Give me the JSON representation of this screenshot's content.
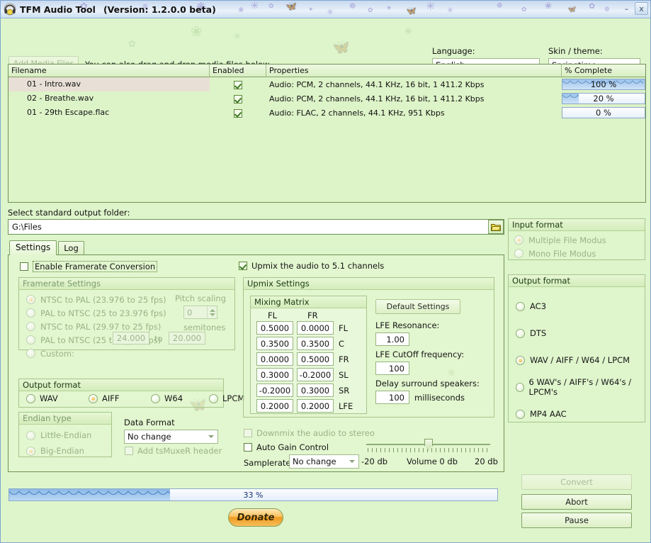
{
  "window": {
    "title": "TFM Audio Tool",
    "version": "(Version: 1.2.0.0 beta)",
    "minimize": "–",
    "maximize": "▫",
    "close": "x",
    "app_icon": "headphones-icon"
  },
  "topbar": {
    "add_media_label": "Add Media Files",
    "drag_hint": "You can also drag and drop media files below.",
    "language_label": "Language:",
    "language_value": "English",
    "skin_label": "Skin / theme:",
    "skin_value": "Springtime"
  },
  "filelist": {
    "columns": [
      "Filename",
      "Enabled",
      "Properties",
      "% Complete"
    ],
    "rows": [
      {
        "filename": "01 - Intro.wav",
        "enabled": true,
        "properties": "Audio: PCM, 2 channels, 44.1 KHz, 16 bit, 1 411.2 Kbps",
        "percent": 100,
        "percent_label": "100 %",
        "selected": true
      },
      {
        "filename": "02 - Breathe.wav",
        "enabled": true,
        "properties": "Audio: PCM, 2 channels, 44.1 KHz, 16 bit, 1 411.2 Kbps",
        "percent": 20,
        "percent_label": "20 %",
        "selected": false
      },
      {
        "filename": "01 - 29th Escape.flac",
        "enabled": true,
        "properties": "Audio: FLAC, 2 channels, 44.1 KHz, 951 Kbps",
        "percent": 0,
        "percent_label": "0 %",
        "selected": false
      }
    ]
  },
  "output_folder": {
    "label": "Select standard output folder:",
    "path": "G:\\Files",
    "browse_icon": "folder-open-icon"
  },
  "tabs": [
    {
      "label": "Settings",
      "active": true
    },
    {
      "label": "Log",
      "active": false
    }
  ],
  "settings": {
    "enable_framerate_conversion": {
      "label": "Enable Framerate Conversion",
      "checked": false
    },
    "upmix_51": {
      "label": "Upmix the audio to 5.1 channels",
      "checked": true
    },
    "framerate": {
      "title": "Framerate Settings",
      "options": [
        {
          "label": "NTSC to PAL (23.976 to 25 fps)",
          "selected": true
        },
        {
          "label": "PAL to NTSC (25 to 23.976 fps)",
          "selected": false
        },
        {
          "label": "NTSC to PAL (29.97 to 25 fps)",
          "selected": false
        },
        {
          "label": "PAL to NTSC (25 to 29.97 fps)",
          "selected": false
        },
        {
          "label": "Custom:",
          "selected": false
        }
      ],
      "custom_from": "24.000",
      "custom_to_label": "to",
      "custom_to": "20.000",
      "pitch_scaling_label": "Pitch scaling",
      "pitch_scaling_value": "0",
      "semitones_label": "semitones"
    },
    "output_format_local": {
      "title": "Output format",
      "options": [
        {
          "label": "WAV",
          "selected": false
        },
        {
          "label": "AIFF",
          "selected": true
        },
        {
          "label": "W64",
          "selected": false
        },
        {
          "label": "LPCM",
          "selected": false
        }
      ]
    },
    "endian": {
      "title": "Endian type",
      "options": [
        {
          "label": "Little-Endian",
          "selected": false
        },
        {
          "label": "Big-Endian",
          "selected": true
        }
      ]
    },
    "data_format": {
      "label": "Data Format",
      "value": "No change"
    },
    "tsmuxer": {
      "label": "Add tsMuxeR header",
      "checked": false
    },
    "upmix": {
      "title": "Upmix Settings",
      "matrix_title": "Mixing Matrix",
      "matrix_columns": [
        "FL",
        "FR"
      ],
      "matrix_rows": [
        {
          "name": "FL",
          "fl": "0.5000",
          "fr": "0.0000"
        },
        {
          "name": "C",
          "fl": "0.3500",
          "fr": "0.3500"
        },
        {
          "name": "FR",
          "fl": "0.0000",
          "fr": "0.5000"
        },
        {
          "name": "SL",
          "fl": "0.3000",
          "fr": "-0.2000"
        },
        {
          "name": "SR",
          "fl": "-0.2000",
          "fr": "0.3000"
        },
        {
          "name": "LFE",
          "fl": "0.2000",
          "fr": "0.2000"
        }
      ],
      "default_settings_label": "Default Settings",
      "lfe_resonance_label": "LFE Resonance:",
      "lfe_resonance_value": "1.00",
      "lfe_cutoff_label": "LFE CutOff frequency:",
      "lfe_cutoff_value": "100",
      "delay_label": "Delay surround speakers:",
      "delay_value": "100",
      "delay_unit": "milliseconds"
    },
    "downmix": {
      "label": "Downmix the audio to stereo",
      "checked": false
    },
    "auto_gain": {
      "label": "Auto Gain Control",
      "checked": false
    },
    "samplerate": {
      "label": "Samplerate:",
      "value": "No change"
    },
    "volume": {
      "min_label": "-20 db",
      "center_label": "Volume 0 db",
      "max_label": "20 db",
      "value": 0
    }
  },
  "input_format": {
    "title": "Input format",
    "options": [
      {
        "label": "Multiple File Modus",
        "selected": true
      },
      {
        "label": "Mono File Modus",
        "selected": false
      }
    ]
  },
  "output_format": {
    "title": "Output format",
    "options": [
      {
        "label": "AC3",
        "selected": false
      },
      {
        "label": "DTS",
        "selected": false
      },
      {
        "label": "WAV / AIFF / W64 / LPCM",
        "selected": true
      },
      {
        "label": "6 WAV's / AIFF's / W64's / LPCM's",
        "selected": false
      },
      {
        "label": "MP4 AAC",
        "selected": false
      }
    ]
  },
  "bottom": {
    "progress_percent": 33,
    "progress_label": "33 %",
    "donate_label": "Donate",
    "convert_label": "Convert",
    "abort_label": "Abort",
    "pause_label": "Pause"
  },
  "colors": {
    "background": "#def5cb",
    "title_bar": "#ccdff0",
    "group_border": "#a6c68a",
    "progress_fill": "#8cb9e6",
    "selected_row": "#e8e0d6",
    "radio_dot": "#e8a32c"
  }
}
